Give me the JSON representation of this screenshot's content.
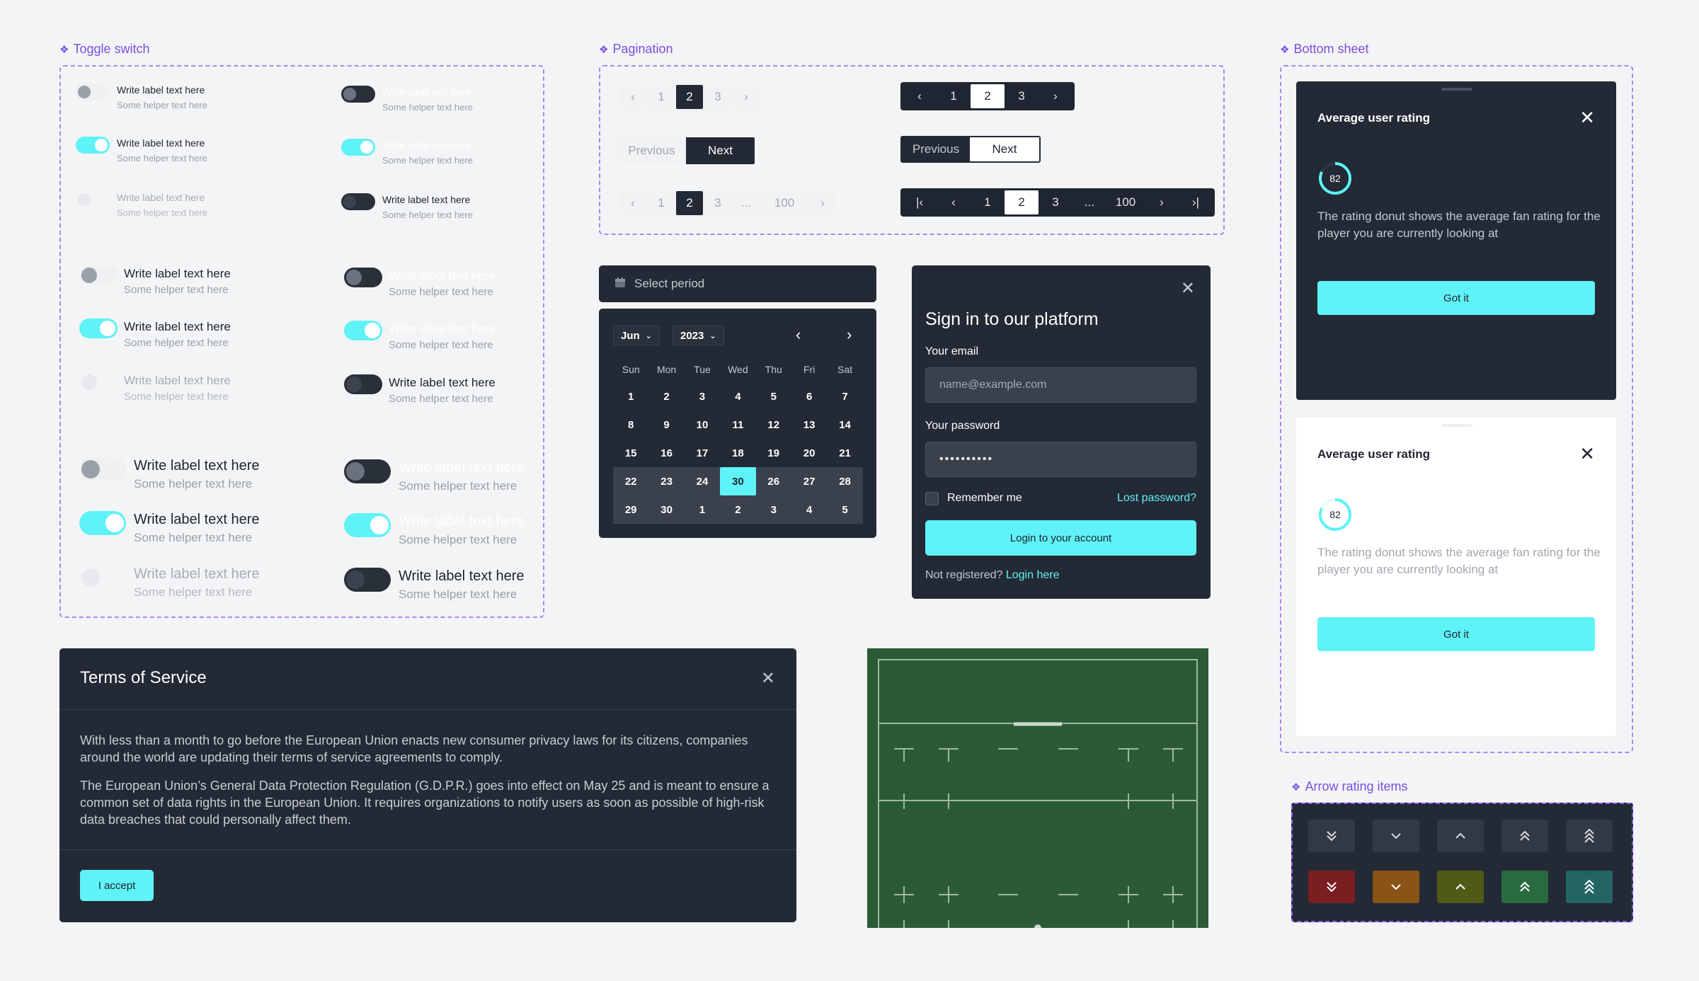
{
  "sections": {
    "toggle": "Toggle switch",
    "pagination": "Pagination",
    "bottom_sheet": "Bottom sheet",
    "arrow_rating": "Arrow rating items"
  },
  "toggle": {
    "label": "Write label text here",
    "helper": "Some helper text here"
  },
  "pagination": {
    "pages": [
      "1",
      "2",
      "3"
    ],
    "long_pages": [
      "1",
      "2",
      "3",
      "...",
      "100"
    ],
    "active": "2",
    "previous": "Previous",
    "next": "Next"
  },
  "period": {
    "placeholder": "Select period",
    "month": "Jun",
    "year": "2023",
    "weekdays": [
      "Sun",
      "Mon",
      "Tue",
      "Wed",
      "Thu",
      "Fri",
      "Sat"
    ],
    "weeks": [
      [
        "1",
        "2",
        "3",
        "4",
        "5",
        "6",
        "7"
      ],
      [
        "8",
        "9",
        "10",
        "11",
        "12",
        "13",
        "14"
      ],
      [
        "15",
        "16",
        "17",
        "18",
        "19",
        "20",
        "21"
      ],
      [
        "22",
        "23",
        "24",
        "30",
        "26",
        "27",
        "28"
      ],
      [
        "29",
        "30",
        "1",
        "2",
        "3",
        "4",
        "5"
      ]
    ],
    "selected": "30"
  },
  "signin": {
    "title": "Sign in to our platform",
    "email_label": "Your email",
    "email_placeholder": "name@example.com",
    "password_label": "Your password",
    "password_value": "••••••••••",
    "remember": "Remember me",
    "lost": "Lost password?",
    "submit": "Login to your account",
    "not_registered": "Not registered?",
    "login_here": "Login here"
  },
  "sheet": {
    "title": "Average user rating",
    "rating": "82",
    "rating_fraction": 0.82,
    "description": "The rating donut shows the average fan rating for the player you are currently looking at",
    "button": "Got it"
  },
  "terms": {
    "title": "Terms of Service",
    "p1": "With less than a month to go before the European Union enacts new consumer privacy laws for its citizens, companies around the world are updating their terms of service agreements to comply.",
    "p2": "The European Union’s General Data Protection Regulation (G.D.P.R.) goes into effect on May 25 and is meant to ensure a common set of data rights in the European Union. It requires organizations to notify users as soon as possible of high-risk data breaches that could personally affect them.",
    "accept": "I accept"
  },
  "colors": {
    "accent": "#5ff2f6",
    "dark": "#232a35",
    "frame": "#a887f0",
    "field": "#2a5b35",
    "rating": [
      "#7a1e22",
      "#8a5414",
      "#4e5a16",
      "#2a6a3f",
      "#236565"
    ]
  },
  "icons": [
    "double-chevron-down-icon",
    "chevron-down-icon",
    "chevron-up-icon",
    "double-chevron-up-icon",
    "triple-chevron-up-icon"
  ]
}
